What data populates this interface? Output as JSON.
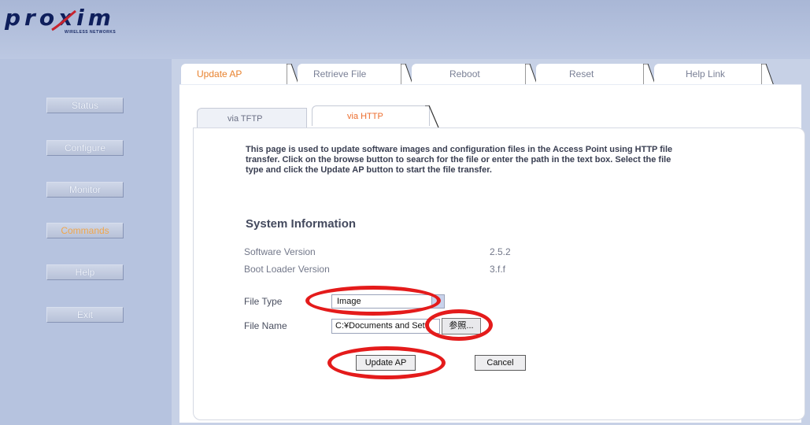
{
  "logo": {
    "word": "proxim",
    "subtitle": "WIRELESS NETWORKS"
  },
  "sidebar": {
    "items": [
      {
        "label": "Status",
        "active": false
      },
      {
        "label": "Configure",
        "active": false
      },
      {
        "label": "Monitor",
        "active": false
      },
      {
        "label": "Commands",
        "active": true
      },
      {
        "label": "Help",
        "active": false
      },
      {
        "label": "Exit",
        "active": false
      }
    ]
  },
  "top_tabs": [
    {
      "label": "Update AP",
      "active": true
    },
    {
      "label": "Retrieve File",
      "active": false
    },
    {
      "label": "Reboot",
      "active": false
    },
    {
      "label": "Reset",
      "active": false
    },
    {
      "label": "Help Link",
      "active": false
    }
  ],
  "sub_tabs": [
    {
      "label": "via TFTP",
      "active": false
    },
    {
      "label": "via HTTP",
      "active": true
    }
  ],
  "description": "This page is used to update software images and configuration files in the Access Point using HTTP file transfer. Click on the browse button to search for the file or enter the path in the text box. Select the file type and click the Update AP button to start the file transfer.",
  "system_info": {
    "title": "System Information",
    "rows": [
      {
        "label": "Software Version",
        "value": "2.5.2"
      },
      {
        "label": "Boot Loader Version",
        "value": "3.f.f"
      }
    ]
  },
  "form": {
    "file_type_label": "File Type",
    "file_type_value": "Image",
    "file_name_label": "File Name",
    "file_name_value": "C:¥Documents and Setti",
    "browse_label": "参照...",
    "update_label": "Update AP",
    "cancel_label": "Cancel"
  },
  "colors": {
    "highlight": "#e41b1b",
    "active_tab": "#e8822e",
    "sidebar_bg": "#b6c3df"
  }
}
